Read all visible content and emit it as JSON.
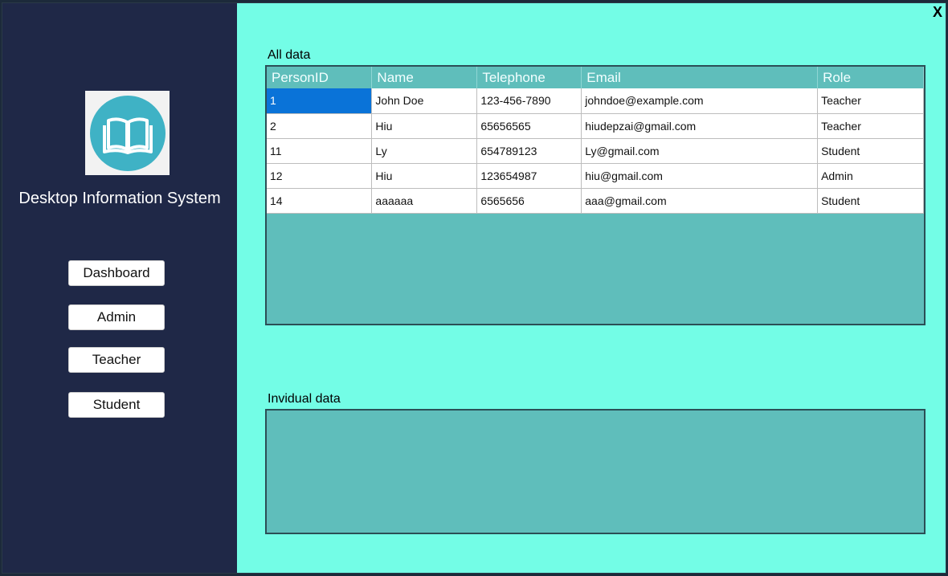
{
  "app": {
    "title": "Desktop Information System",
    "close_label": "X"
  },
  "nav": {
    "dashboard": "Dashboard",
    "admin": "Admin",
    "teacher": "Teacher",
    "student": "Student"
  },
  "sections": {
    "all_data": "All data",
    "individual_data": "Invidual data"
  },
  "table": {
    "columns": [
      "PersonID",
      "Name",
      "Telephone",
      "Email",
      "Role"
    ],
    "rows": [
      [
        "1",
        "John Doe",
        "123-456-7890",
        "johndoe@example.com",
        "Teacher"
      ],
      [
        "2",
        "Hiu",
        "65656565",
        "hiudepzai@gmail.com",
        "Teacher"
      ],
      [
        "11",
        "Ly",
        "654789123",
        "Ly@gmail.com",
        "Student"
      ],
      [
        "12",
        "Hiu",
        "123654987",
        "hiu@gmail.com",
        "Admin"
      ],
      [
        "14",
        "aaaaaa",
        "6565656",
        "aaa@gmail.com",
        "Student"
      ]
    ],
    "selected_cell": "1"
  },
  "colors": {
    "sidebar": "#1f2847",
    "content_background": "#73fde6",
    "grid_background": "#5fbebb",
    "selection": "#0a73d8",
    "logo_circle": "#3fb2c5"
  },
  "icons": {
    "logo": "open-book-icon",
    "close": "close-icon"
  }
}
